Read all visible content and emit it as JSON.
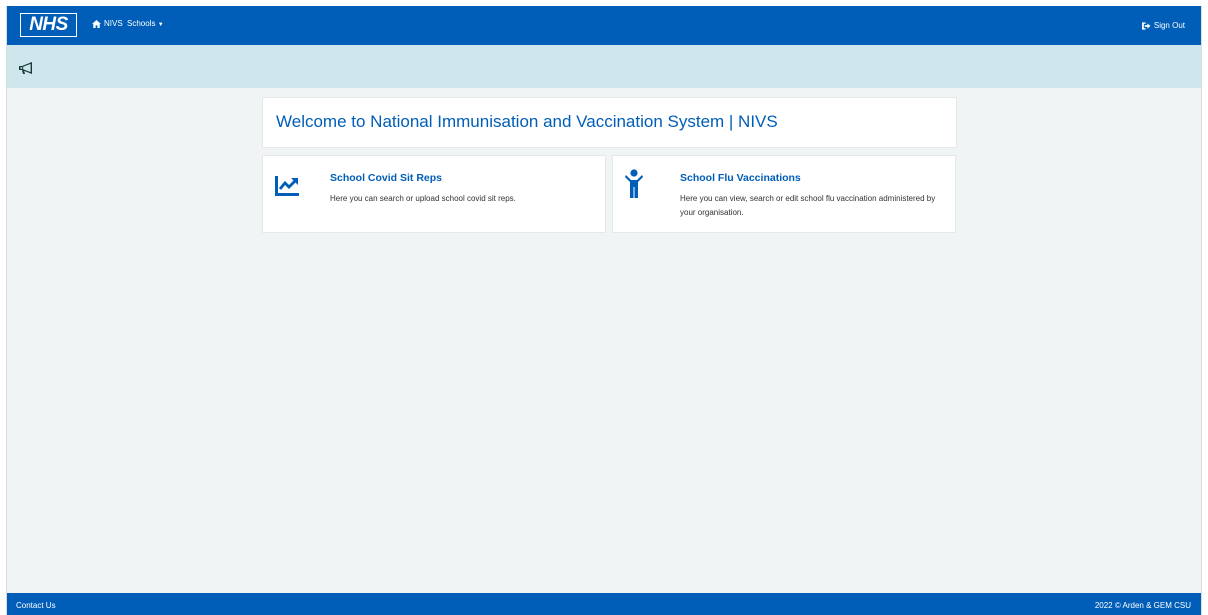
{
  "header": {
    "logo_text": "NHS",
    "home_label": "NIVS",
    "schools_label": "Schools",
    "sign_out_label": "Sign Out"
  },
  "welcome": {
    "title": "Welcome to National Immunisation and Vaccination System | NIVS"
  },
  "tiles": [
    {
      "title": "School Covid Sit Reps",
      "description": "Here you can search or upload school covid sit reps.",
      "icon": "chart-line-icon"
    },
    {
      "title": "School Flu Vaccinations",
      "description": "Here you can view, search or edit school flu vaccination administered by your organisation.",
      "icon": "child-icon"
    }
  ],
  "footer": {
    "contact_label": "Contact Us",
    "copyright": "2022 © Arden & GEM CSU"
  },
  "colors": {
    "brand": "#005eb8",
    "notice_bar": "#cfe7ec",
    "page_bg": "#f0f4f5"
  }
}
